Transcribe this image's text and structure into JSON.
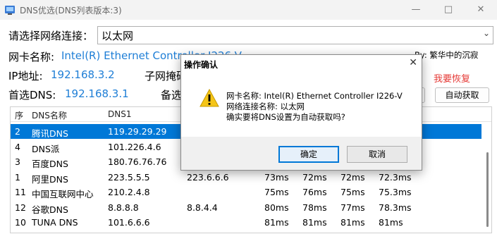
{
  "window": {
    "title": "DNS优选(DNS列表版本:3)",
    "min": "—",
    "max": "□",
    "close": "✕"
  },
  "form": {
    "adapter_prompt": "请选择网络连接：",
    "adapter_selected": "以太网",
    "nic_label": "网卡名称:",
    "nic_value": "Intel(R) Ethernet Controller I226-V",
    "author": "By: 繁华中的沉寂",
    "ip_label": "IP地址:",
    "ip_value": "192.168.3.2",
    "mask_label": "子网掩码:",
    "restore_link": "我要恢复",
    "dns_label": "首选DNS:",
    "dns_value": "192.168.3.1",
    "alt_dns_label": "备选DNS:",
    "auto_button": "自动获取"
  },
  "table": {
    "headers": [
      "序",
      "DNS名称",
      "DNS1"
    ],
    "rows": [
      {
        "id": "2",
        "name": "腾讯DNS",
        "dns1": "119.29.29.29",
        "dns2": "",
        "t1": "",
        "t2": "",
        "t3": "",
        "avg": "",
        "selected": true
      },
      {
        "id": "4",
        "name": "DNS派",
        "dns1": "101.226.4.6",
        "dns2": "",
        "t1": "",
        "t2": "",
        "t3": "",
        "avg": ""
      },
      {
        "id": "3",
        "name": "百度DNS",
        "dns1": "180.76.76.76",
        "dns2": "",
        "t1": "",
        "t2": "",
        "t3": "",
        "avg": ""
      },
      {
        "id": "1",
        "name": "阿里DNS",
        "dns1": "223.5.5.5",
        "dns2": "223.6.6.6",
        "t1": "73ms",
        "t2": "72ms",
        "t3": "72ms",
        "avg": "72.3ms"
      },
      {
        "id": "11",
        "name": "中国互联网中心",
        "dns1": "210.2.4.8",
        "dns2": "",
        "t1": "75ms",
        "t2": "76ms",
        "t3": "75ms",
        "avg": "75.3ms"
      },
      {
        "id": "12",
        "name": "谷歌DNS",
        "dns1": "8.8.8.8",
        "dns2": "8.8.4.4",
        "t1": "80ms",
        "t2": "78ms",
        "t3": "77ms",
        "avg": "78.3ms"
      },
      {
        "id": "10",
        "name": "TUNA DNS",
        "dns1": "101.6.6.6",
        "dns2": "",
        "t1": "81ms",
        "t2": "81ms",
        "t3": "81ms",
        "avg": "81ms"
      }
    ]
  },
  "dialog": {
    "title": "操作确认",
    "close": "✕",
    "line1": "网卡名称: Intel(R) Ethernet Controller I226-V",
    "line2": "网络连接名称: 以太网",
    "line3": "确实要将DNS设置为自动获取吗?",
    "ok": "确定",
    "cancel": "取消"
  },
  "colors": {
    "accent": "#1e7ed6",
    "selection": "#0078d7",
    "warning": "#e53935"
  }
}
